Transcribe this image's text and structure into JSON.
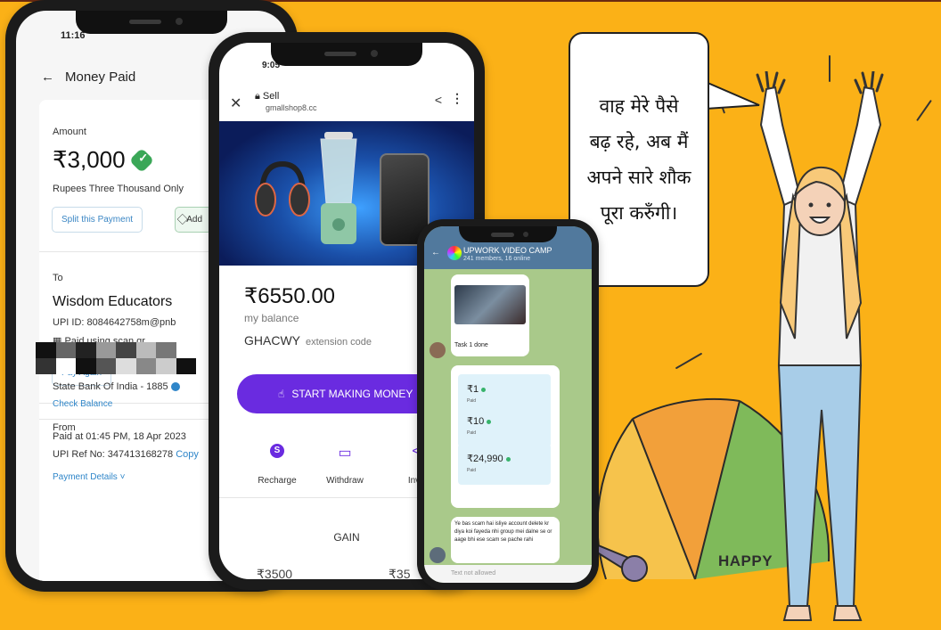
{
  "phone1": {
    "status_time": "11:16",
    "header_title": "Money Paid",
    "amount_label": "Amount",
    "amount": "₹3,000",
    "amount_words": "Rupees Three Thousand Only",
    "split_button": "Split this Payment",
    "add_button": "Add",
    "to_label": "To",
    "payee_name": "Wisdom Educators",
    "upi_id": "UPI ID: 8084642758m@pnb",
    "paid_using": "Paid using scan qr",
    "pay_again_button": "Pay Again",
    "from_label": "From",
    "bank": "State Bank Of India - 1885",
    "check_balance": "Check Balance",
    "paid_at": "Paid at 01:45 PM, 18 Apr 2023",
    "upi_ref": "UPI Ref No: 347413168278",
    "copy": "Copy",
    "payment_details": "Payment Details"
  },
  "phone2": {
    "status_time": "9:05",
    "title": "Sell",
    "url": "gmallshop8.cc",
    "balance": "₹6550.00",
    "my_balance": "my balance",
    "code": "GHACWY",
    "code_label": "extension code",
    "cta": "START MAKING MONEY",
    "actions": [
      {
        "icon": "S",
        "label": "Recharge"
      },
      {
        "icon": "▭",
        "label": "Withdraw"
      },
      {
        "icon": "<",
        "label": "Invit"
      }
    ],
    "gain_label": "GAIN",
    "bottom_left": "₹3500",
    "bottom_right": "₹35"
  },
  "phone3": {
    "group_name": "UPWORK VIDEO CAMP",
    "members": "241 members, 16 online",
    "msg_task": "Task 1 done",
    "payments": [
      {
        "amount": "₹1",
        "status": "Paid"
      },
      {
        "amount": "₹10",
        "status": "Paid"
      },
      {
        "amount": "₹24,990",
        "status": "Paid"
      }
    ],
    "msg_scam": "Ye bas scam hai isliye account delete kr diya koi fayeda nhi group mei dalne se or aage bhi ese scam se pache rahi",
    "input_placeholder": "Text not allowed"
  },
  "speech_text": "वाह मेरे पैसे बढ़ रहे, अब मैं अपने सारे शौक पूरा करुँगी।",
  "gauge": {
    "label": "HAPPY",
    "colors": {
      "yellow": "#f6c34c",
      "orange": "#f2a03a",
      "green": "#7fba5a",
      "needle": "#8b7fa8"
    }
  },
  "colors": {
    "background": "#fbb117",
    "accent_purple": "#6a2be0"
  }
}
